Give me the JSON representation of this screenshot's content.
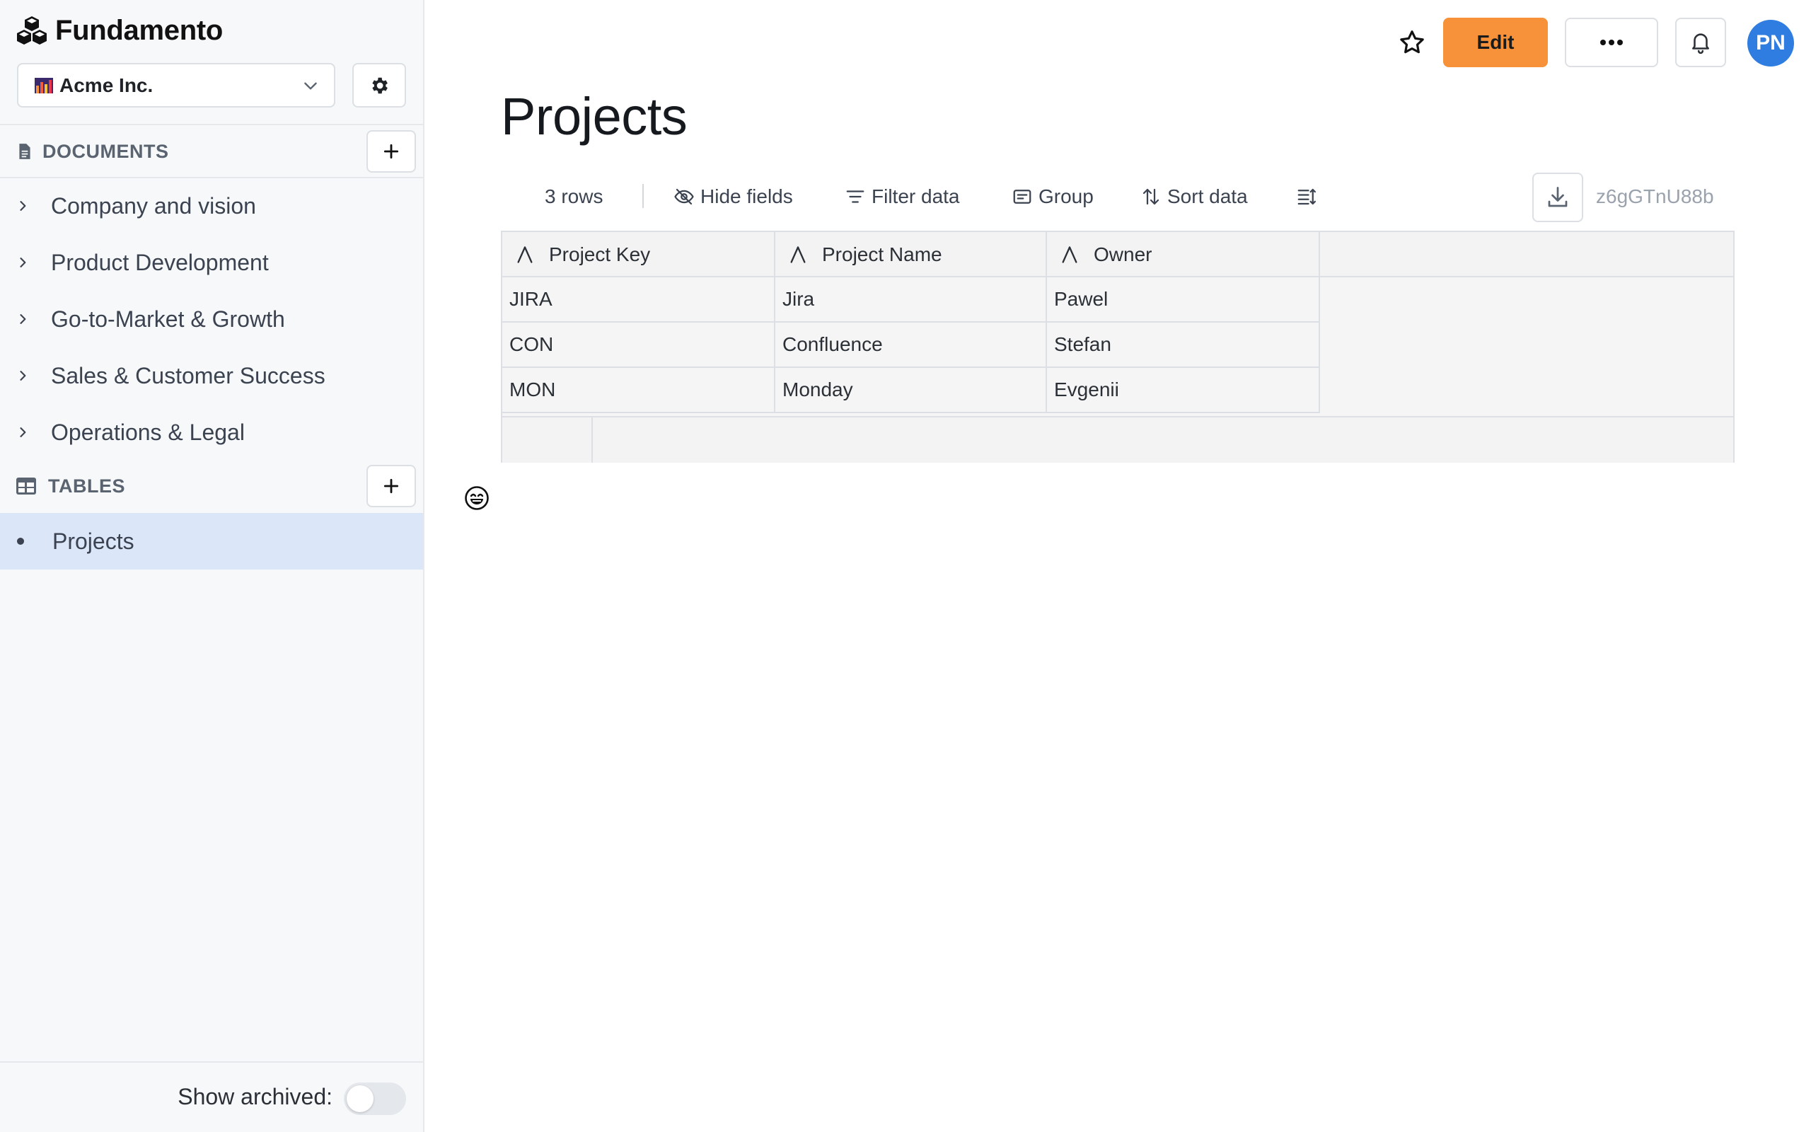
{
  "app": {
    "name": "Fundamento"
  },
  "workspace": {
    "name": "Acme Inc."
  },
  "sidebar": {
    "documents_label": "DOCUMENTS",
    "documents": [
      {
        "label": "Company and vision"
      },
      {
        "label": "Product Development"
      },
      {
        "label": "Go-to-Market & Growth"
      },
      {
        "label": "Sales & Customer Success"
      },
      {
        "label": "Operations & Legal"
      }
    ],
    "tables_label": "TABLES",
    "tables": [
      {
        "label": "Projects",
        "selected": true
      }
    ],
    "show_archived_label": "Show archived:",
    "show_archived": false
  },
  "topbar": {
    "edit_label": "Edit",
    "avatar_initials": "PN"
  },
  "page": {
    "title": "Projects"
  },
  "toolbar": {
    "rows": "3 rows",
    "hide_fields": "Hide fields",
    "filter": "Filter data",
    "group": "Group",
    "sort": "Sort data",
    "doc_id": "z6gGTnU88b"
  },
  "table": {
    "columns": [
      "Project Key",
      "Project Name",
      "Owner"
    ],
    "rows": [
      [
        "JIRA",
        "Jira",
        "Pawel"
      ],
      [
        "CON",
        "Confluence",
        "Stefan"
      ],
      [
        "MON",
        "Monday",
        "Evgenii"
      ]
    ]
  },
  "colors": {
    "accent": "#f7923a",
    "selected_item": "#dbe6f9",
    "avatar": "#2f7de1"
  }
}
